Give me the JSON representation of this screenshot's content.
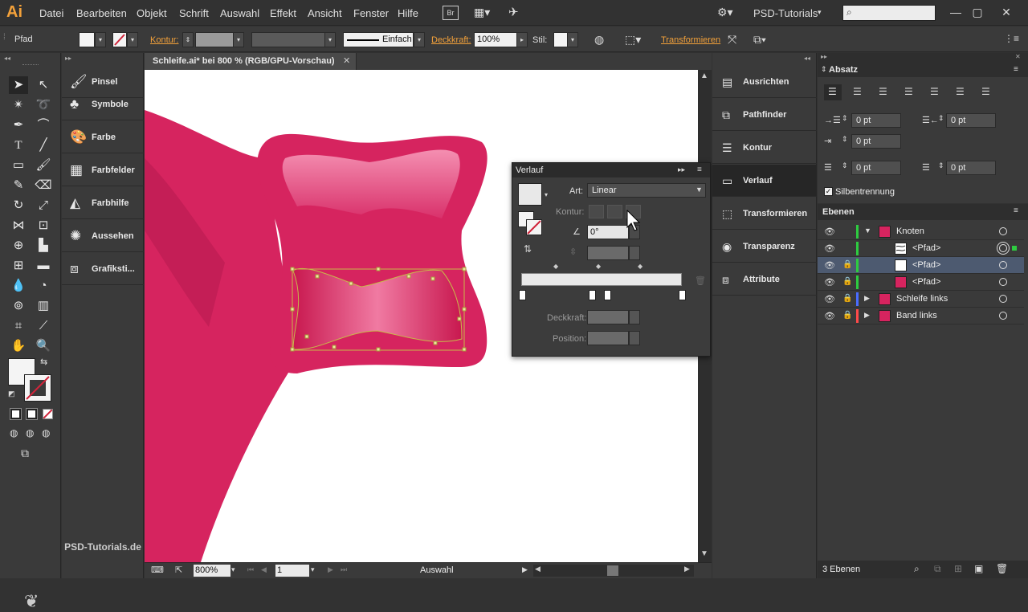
{
  "app": {
    "logo": "Ai",
    "workspace": "PSD-Tutorials",
    "search_placeholder": ""
  },
  "menu": [
    "Datei",
    "Bearbeiten",
    "Objekt",
    "Schrift",
    "Auswahl",
    "Effekt",
    "Ansicht",
    "Fenster",
    "Hilfe"
  ],
  "control_bar": {
    "selection_type": "Pfad",
    "kontur_label": "Kontur:",
    "stroke_style": "Einfach",
    "deckkraft_label": "Deckkraft:",
    "deckkraft_value": "100%",
    "stil_label": "Stil:",
    "transform_label": "Transformieren"
  },
  "left_panels": [
    "Pinsel",
    "Symbole",
    "Farbe",
    "Farbfelder",
    "Farbhilfe",
    "Aussehen",
    "Grafiksti..."
  ],
  "document": {
    "tab_title": "Schleife.ai* bei 800 % (RGB/GPU-Vorschau)",
    "zoom": "800%",
    "artboard": "1",
    "status": "Auswahl"
  },
  "verlauf": {
    "title": "Verlauf",
    "art_label": "Art:",
    "art_value": "Linear",
    "kontur_label": "Kontur:",
    "angle_value": "0°",
    "deckkraft_label": "Deckkraft:",
    "position_label": "Position:"
  },
  "right_panels": [
    "Ausrichten",
    "Pathfinder",
    "Kontur",
    "Verlauf",
    "Transformieren",
    "Transparenz",
    "Attribute"
  ],
  "absatz": {
    "title": "Absatz",
    "indent_left": "0 pt",
    "indent_right": "0 pt",
    "first_line": "0 pt",
    "space_before": "0 pt",
    "space_after": "0 pt",
    "hyphenation": "Silbentrennung"
  },
  "ebenen": {
    "title": "Ebenen",
    "layers": [
      {
        "name": "Knoten",
        "color": "#2ecc40"
      },
      {
        "name": "<Pfad>"
      },
      {
        "name": "<Pfad>"
      },
      {
        "name": "<Pfad>"
      },
      {
        "name": "Schleife links",
        "color": "#4a6cff"
      },
      {
        "name": "Band links",
        "color": "#ff4a4a"
      }
    ],
    "count": "3 Ebenen"
  },
  "watermark": "PSD-Tutorials.de",
  "colors": {
    "accent": "#f3a13a",
    "shape": "#d6245f",
    "selection": "#c8b84a"
  }
}
